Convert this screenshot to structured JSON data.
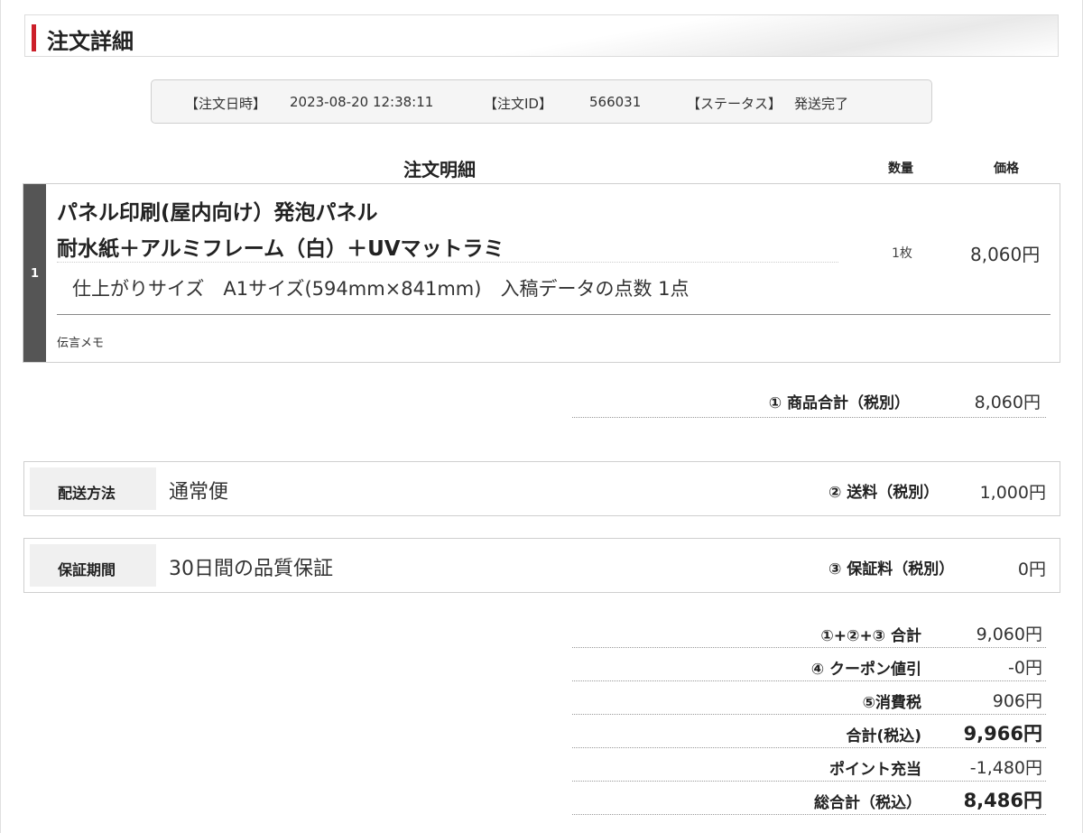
{
  "header": {
    "title": "注文詳細"
  },
  "info": {
    "date_label": "【注文日時】",
    "date_value": "2023-08-20 12:38:11",
    "id_label": "【注文ID】",
    "id_value": "566031",
    "status_label": "【ステータス】",
    "status_value": "発送完了"
  },
  "detail": {
    "title": "注文明細",
    "qty_header": "数量",
    "price_header": "価格"
  },
  "item": {
    "number": "1",
    "name_line1": "パネル印刷(屋内向け）発泡パネル",
    "name_line2": "耐水紙＋アルミフレーム（白）＋UVマットラミ",
    "size_info": "仕上がりサイズ　A1サイズ(594mm×841mm)　入稿データの点数  1点",
    "quantity": "1枚",
    "price": "8,060円",
    "memo_label": "伝言メモ"
  },
  "subtotal": {
    "label": "① 商品合計（税別）",
    "value": "8,060円"
  },
  "shipping": {
    "label": "配送方法",
    "value": "通常便",
    "fee_label": "② 送料（税別）",
    "fee_value": "1,000円"
  },
  "warranty": {
    "label": "保証期間",
    "value": "30日間の品質保証",
    "fee_label": "③ 保証料（税別）",
    "fee_value": "0円"
  },
  "totals": [
    {
      "label": "①+②+③ 合計",
      "value": "9,060円",
      "strong": false
    },
    {
      "label": "④ クーポン値引",
      "value": "-0円",
      "strong": false
    },
    {
      "label": "⑤消費税",
      "value": "906円",
      "strong": false
    },
    {
      "label": "合計(税込)",
      "value": "9,966円",
      "strong": true
    },
    {
      "label": "ポイント充当",
      "value": "-1,480円",
      "strong": false
    },
    {
      "label": "総合計（税込）",
      "value": "8,486円",
      "strong": true
    }
  ],
  "colors": {
    "accent": "#cc1f2a",
    "item_number_bg": "#555555",
    "label_cell_bg": "#f0f0f0"
  }
}
